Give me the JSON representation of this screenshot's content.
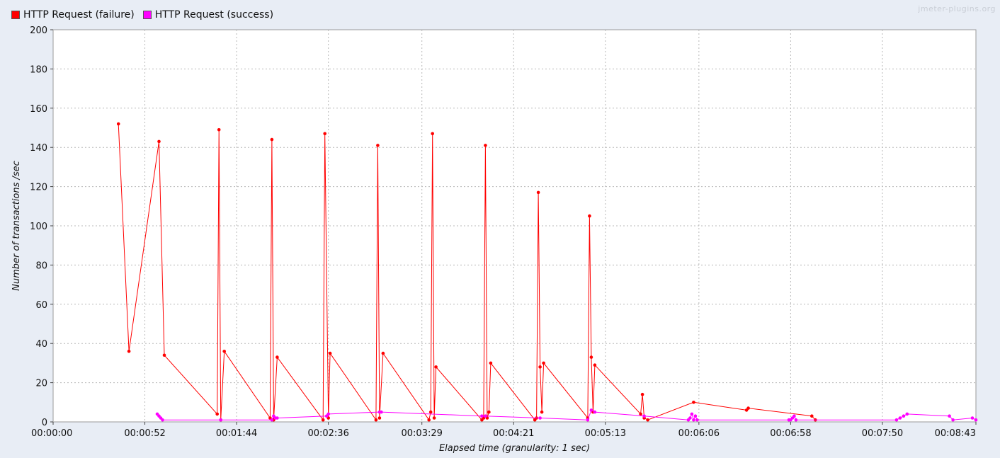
{
  "watermark": "jmeter-plugins.org",
  "chart_data": {
    "type": "line",
    "xlabel": "Elapsed time (granularity: 1 sec)",
    "ylabel": "Number of transactions /sec",
    "xlim": [
      "00:00:00",
      "00:08:43"
    ],
    "ylim": [
      0,
      200
    ],
    "y_ticks": [
      0,
      20,
      40,
      60,
      80,
      100,
      120,
      140,
      160,
      180,
      200
    ],
    "x_ticks": [
      "00:00:00",
      "00:00:52",
      "00:01:44",
      "00:02:36",
      "00:03:29",
      "00:04:21",
      "00:05:13",
      "00:06:06",
      "00:06:58",
      "00:07:50",
      "00:08:43"
    ],
    "grid": true,
    "legend_position": "top-left",
    "series": [
      {
        "name": "HTTP Request (failure)",
        "color": "#ff0000",
        "points": [
          [
            "00:00:37",
            152
          ],
          [
            "00:00:43",
            36
          ],
          [
            "00:01:00",
            143
          ],
          [
            "00:01:03",
            34
          ],
          [
            "00:01:33",
            4
          ],
          [
            "00:01:34",
            149
          ],
          [
            "00:01:35",
            1
          ],
          [
            "00:01:37",
            36
          ],
          [
            "00:02:03",
            2
          ],
          [
            "00:02:04",
            144
          ],
          [
            "00:02:05",
            1
          ],
          [
            "00:02:07",
            33
          ],
          [
            "00:02:33",
            1
          ],
          [
            "00:02:34",
            147
          ],
          [
            "00:02:36",
            2
          ],
          [
            "00:02:37",
            35
          ],
          [
            "00:03:03",
            1
          ],
          [
            "00:03:04",
            141
          ],
          [
            "00:03:05",
            2
          ],
          [
            "00:03:07",
            35
          ],
          [
            "00:03:33",
            1
          ],
          [
            "00:03:34",
            5
          ],
          [
            "00:03:35",
            147
          ],
          [
            "00:03:36",
            2
          ],
          [
            "00:03:37",
            28
          ],
          [
            "00:04:03",
            1
          ],
          [
            "00:04:04",
            2
          ],
          [
            "00:04:05",
            141
          ],
          [
            "00:04:06",
            2
          ],
          [
            "00:04:07",
            5
          ],
          [
            "00:04:08",
            30
          ],
          [
            "00:04:33",
            1
          ],
          [
            "00:04:34",
            2
          ],
          [
            "00:04:35",
            117
          ],
          [
            "00:04:36",
            28
          ],
          [
            "00:04:37",
            5
          ],
          [
            "00:04:38",
            30
          ],
          [
            "00:05:03",
            2
          ],
          [
            "00:05:04",
            105
          ],
          [
            "00:05:05",
            33
          ],
          [
            "00:05:06",
            5
          ],
          [
            "00:05:07",
            29
          ],
          [
            "00:05:33",
            4
          ],
          [
            "00:05:34",
            14
          ],
          [
            "00:05:35",
            2
          ],
          [
            "00:05:37",
            1
          ],
          [
            "00:06:03",
            10
          ],
          [
            "00:06:33",
            6
          ],
          [
            "00:06:34",
            7
          ],
          [
            "00:07:10",
            3
          ],
          [
            "00:07:12",
            1
          ]
        ]
      },
      {
        "name": "HTTP Request (success)",
        "color": "#ff00ff",
        "points": [
          [
            "00:00:59",
            4
          ],
          [
            "00:01:00",
            3
          ],
          [
            "00:01:01",
            2
          ],
          [
            "00:01:02",
            1
          ],
          [
            "00:01:35",
            1
          ],
          [
            "00:02:04",
            1
          ],
          [
            "00:02:05",
            3
          ],
          [
            "00:02:06",
            2
          ],
          [
            "00:02:07",
            2
          ],
          [
            "00:02:35",
            3
          ],
          [
            "00:02:36",
            4
          ],
          [
            "00:03:05",
            5
          ],
          [
            "00:03:06",
            5
          ],
          [
            "00:04:03",
            3
          ],
          [
            "00:04:05",
            3
          ],
          [
            "00:04:36",
            2
          ],
          [
            "00:05:03",
            1
          ],
          [
            "00:05:05",
            6
          ],
          [
            "00:05:07",
            5
          ],
          [
            "00:05:35",
            3
          ],
          [
            "00:06:00",
            1
          ],
          [
            "00:06:01",
            2
          ],
          [
            "00:06:02",
            4
          ],
          [
            "00:06:03",
            1
          ],
          [
            "00:06:04",
            3
          ],
          [
            "00:06:05",
            1
          ],
          [
            "00:06:57",
            1
          ],
          [
            "00:06:58",
            1
          ],
          [
            "00:06:59",
            2
          ],
          [
            "00:07:00",
            3
          ],
          [
            "00:07:01",
            1
          ],
          [
            "00:07:58",
            1
          ],
          [
            "00:08:00",
            2
          ],
          [
            "00:08:02",
            3
          ],
          [
            "00:08:04",
            4
          ],
          [
            "00:08:28",
            3
          ],
          [
            "00:08:30",
            1
          ],
          [
            "00:08:41",
            2
          ],
          [
            "00:08:43",
            1
          ]
        ]
      }
    ]
  }
}
